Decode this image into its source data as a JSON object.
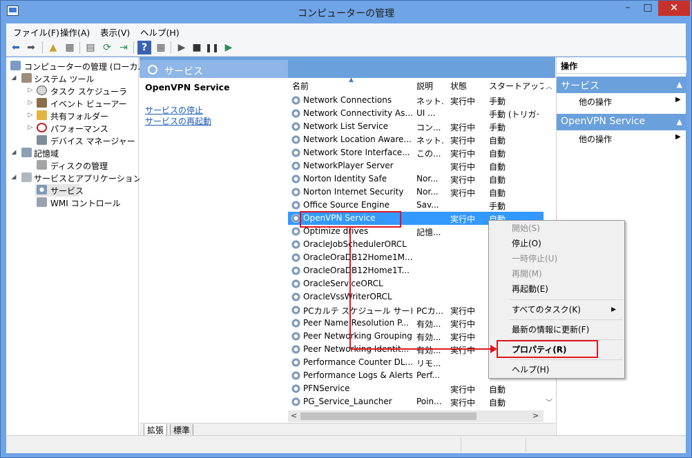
{
  "window": {
    "title": "コンピューターの管理"
  },
  "title_controls": {
    "minimize": "–",
    "maximize": "□",
    "close": "✕"
  },
  "menu": [
    "ファイル(F)",
    "操作(A)",
    "表示(V)",
    "ヘルプ(H)"
  ],
  "tree": [
    {
      "label": "コンピューターの管理 (ローカル)"
    },
    {
      "label": "システム ツール"
    },
    {
      "label": "タスク スケジューラ"
    },
    {
      "label": "イベント ビューアー"
    },
    {
      "label": "共有フォルダー"
    },
    {
      "label": "パフォーマンス"
    },
    {
      "label": "デバイス マネージャー"
    },
    {
      "label": "記憶域"
    },
    {
      "label": "ディスクの管理"
    },
    {
      "label": "サービスとアプリケーション"
    },
    {
      "label": "サービス"
    },
    {
      "label": "WMI コントロール"
    }
  ],
  "center": {
    "title": "サービス",
    "detail_title": "OpenVPN Service",
    "links": [
      "サービスの停止",
      "サービスの再起動"
    ],
    "columns": [
      "名前",
      "説明",
      "状態",
      "スタートアップの種"
    ],
    "rows": [
      {
        "name": "Network Connections",
        "desc": "ネット...",
        "state": "実行中",
        "startup": "手動"
      },
      {
        "name": "Network Connectivity As...",
        "desc": "UI ...",
        "state": "",
        "startup": "手動 (トリガー開"
      },
      {
        "name": "Network List Service",
        "desc": "コン...",
        "state": "実行中",
        "startup": "手動"
      },
      {
        "name": "Network Location Aware...",
        "desc": "ネット...",
        "state": "実行中",
        "startup": "自動"
      },
      {
        "name": "Network Store Interface...",
        "desc": "この...",
        "state": "実行中",
        "startup": "自動"
      },
      {
        "name": "NetworkPlayer Server",
        "desc": "",
        "state": "実行中",
        "startup": "自動"
      },
      {
        "name": "Norton Identity Safe",
        "desc": "Nor...",
        "state": "実行中",
        "startup": "自動"
      },
      {
        "name": "Norton Internet Security",
        "desc": "Nor...",
        "state": "実行中",
        "startup": "自動"
      },
      {
        "name": "Office  Source Engine",
        "desc": "Sav...",
        "state": "",
        "startup": "手動"
      },
      {
        "name": "OpenVPN Service",
        "desc": "",
        "state": "実行中",
        "startup": "自動"
      },
      {
        "name": "Optimize drives",
        "desc": "記憶...",
        "state": "",
        "startup": ""
      },
      {
        "name": "OracleJobSchedulerORCL",
        "desc": "",
        "state": "",
        "startup": ""
      },
      {
        "name": "OracleOraDB12Home1M...",
        "desc": "",
        "state": "",
        "startup": ""
      },
      {
        "name": "OracleOraDB12Home1T...",
        "desc": "",
        "state": "",
        "startup": ""
      },
      {
        "name": "OracleServiceORCL",
        "desc": "",
        "state": "",
        "startup": ""
      },
      {
        "name": "OracleVssWriterORCL",
        "desc": "",
        "state": "",
        "startup": ""
      },
      {
        "name": "PCカルテ スケジュール サービス",
        "desc": "PCカ...",
        "state": "実行中",
        "startup": ""
      },
      {
        "name": "Peer Name Resolution P...",
        "desc": "有効...",
        "state": "実行中",
        "startup": ""
      },
      {
        "name": "Peer Networking Grouping",
        "desc": "有効...",
        "state": "実行中",
        "startup": ""
      },
      {
        "name": "Peer Networking Identit...",
        "desc": "有効...",
        "state": "実行中",
        "startup": ""
      },
      {
        "name": "Performance Counter DL...",
        "desc": "リモ...",
        "state": "",
        "startup": ""
      },
      {
        "name": "Performance Logs & Alerts",
        "desc": "Perf...",
        "state": "",
        "startup": ""
      },
      {
        "name": "PFNService",
        "desc": "",
        "state": "実行中",
        "startup": "自動"
      },
      {
        "name": "PG_Service_Launcher",
        "desc": "Poin...",
        "state": "実行中",
        "startup": "自動"
      }
    ],
    "tabs": [
      "拡張",
      "標準"
    ]
  },
  "actions": {
    "title": "操作",
    "sec1": "サービス",
    "sec1_item": "他の操作",
    "sec2": "OpenVPN Service",
    "sec2_item": "他の操作"
  },
  "context_menu": {
    "start": "開始(S)",
    "stop": "停止(O)",
    "pause": "一時停止(U)",
    "resume": "再開(M)",
    "restart": "再起動(E)",
    "all_tasks": "すべてのタスク(K)",
    "refresh": "最新の情報に更新(F)",
    "properties": "プロパティ(R)",
    "help": "ヘルプ(H)"
  },
  "colors": {
    "title_bar": "#6fa4e6",
    "selection": "#3399ff",
    "annotation": "#e0141e",
    "close_button": "#c7312b"
  }
}
